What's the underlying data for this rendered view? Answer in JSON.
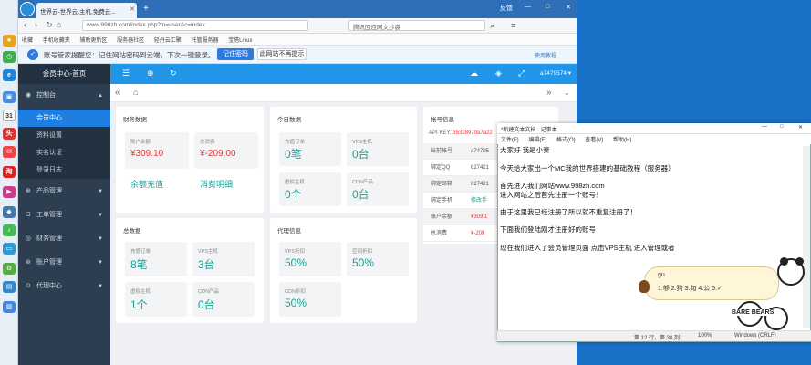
{
  "browser": {
    "tab_title": "世界云-世界云,主机,免费云...",
    "url": "www.998zh.com/index.php?m=user&c=index",
    "search_text": "腾讯回应网文抄袭",
    "window_controls": [
      "反馈",
      "—",
      "□",
      "✕"
    ],
    "favorites": [
      "收藏",
      "手机收藏夹",
      "辅助更新区",
      "服务器社区",
      "轻丹云汇聚",
      "托管服务器",
      "宝塔Linux"
    ],
    "password_notice": "账号管家提醒您：记住网站密码到云端，下次一键登录。",
    "remember_btn": "记住密码",
    "never_btn": "此网站不再提示",
    "help": "使用教程"
  },
  "sidebar": {
    "header": "会员中心-首页",
    "menu": [
      {
        "label": "控制台",
        "icon": "◉"
      },
      {
        "label": "产品管理",
        "icon": "⊕"
      },
      {
        "label": "工单管理",
        "icon": "⊡"
      },
      {
        "label": "财务管理",
        "icon": "◎"
      },
      {
        "label": "账户管理",
        "icon": "⊛"
      },
      {
        "label": "代理中心",
        "icon": "⊙"
      }
    ],
    "submenu": [
      "会员中心",
      "资料设置",
      "实名认证",
      "登录日志"
    ]
  },
  "topnav": {
    "user": "a7479574 ▾"
  },
  "finance": {
    "title": "财务数据",
    "balance_label": "账户余额",
    "balance": "¥309.10",
    "consumed_label": "总消费",
    "consumed": "¥-209.00",
    "recharge": "余额充值",
    "details": "消费明细"
  },
  "today": {
    "title": "今日数据",
    "stats": [
      {
        "label": "充值订单",
        "value": "0笔"
      },
      {
        "label": "VPS主机",
        "value": "0台"
      },
      {
        "label": "虚拟主机",
        "value": "0个"
      },
      {
        "label": "CDN产品",
        "value": "0台"
      }
    ]
  },
  "account": {
    "title": "帐号信息",
    "api_label": "API KEY:",
    "api_key": "35328979a7a22",
    "rows": [
      {
        "label": "当前帐号",
        "value": "a74795"
      },
      {
        "label": "绑定QQ",
        "value": "627421"
      },
      {
        "label": "绑定邮箱",
        "value": "627421"
      },
      {
        "label": "绑定手机",
        "value": "修改手"
      },
      {
        "label": "账户余额",
        "value": "¥309.1"
      },
      {
        "label": "总消费",
        "value": "¥-209"
      }
    ]
  },
  "total": {
    "title": "总数据",
    "stats": [
      {
        "label": "充值订单",
        "value": "8笔"
      },
      {
        "label": "VPS主机",
        "value": "3台"
      },
      {
        "label": "虚拟主机",
        "value": "1个"
      },
      {
        "label": "CDN产品",
        "value": "0台"
      }
    ]
  },
  "agent": {
    "title": "代理信息",
    "stats": [
      {
        "label": "VPS折扣",
        "value": "50%"
      },
      {
        "label": "空间折扣",
        "value": "50%"
      },
      {
        "label": "CDN折扣",
        "value": "50%"
      }
    ]
  },
  "notepad": {
    "title": "*新建文本文档 - 记事本",
    "menu": [
      "文件(F)",
      "编辑(E)",
      "格式(O)",
      "查看(V)",
      "帮助(H)"
    ],
    "lines": [
      "大家好  我是小秦",
      "今天给大家出一个MC我的世界搭建的基础教程（服务器）",
      "首先进入我们网站www.998zh.com",
      "进入网站之后首先注册一个账号！",
      "由于这里我已经注册了所以就不重复注册了！",
      "下面我们登陆刚才注册好的账号",
      "现在我们进入了会员管理页面  点击VPS主机 进入管理或者"
    ],
    "status": "第 12 行，第 30 列",
    "zoom": "100%",
    "encoding": "Windows (CRLF)"
  },
  "ime": {
    "input": "gu",
    "candidates": "1.够  2.狗  3.勾  4.公  5.✓"
  },
  "sticker": "BARE BEARS"
}
